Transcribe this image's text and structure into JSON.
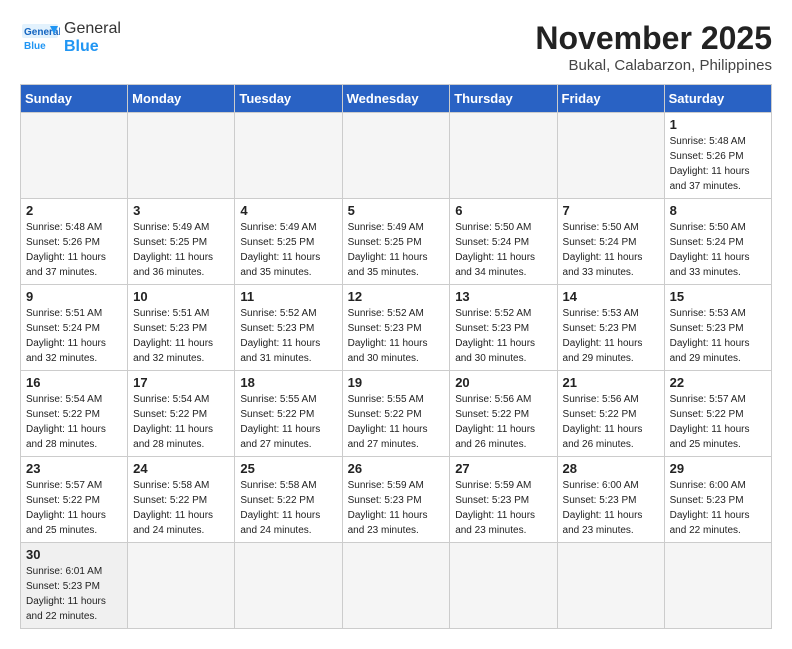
{
  "header": {
    "logo_general": "General",
    "logo_blue": "Blue",
    "month_title": "November 2025",
    "location": "Bukal, Calabarzon, Philippines"
  },
  "weekdays": [
    "Sunday",
    "Monday",
    "Tuesday",
    "Wednesday",
    "Thursday",
    "Friday",
    "Saturday"
  ],
  "weeks": [
    [
      {
        "day": "",
        "info": ""
      },
      {
        "day": "",
        "info": ""
      },
      {
        "day": "",
        "info": ""
      },
      {
        "day": "",
        "info": ""
      },
      {
        "day": "",
        "info": ""
      },
      {
        "day": "",
        "info": ""
      },
      {
        "day": "1",
        "info": "Sunrise: 5:48 AM\nSunset: 5:26 PM\nDaylight: 11 hours\nand 37 minutes."
      }
    ],
    [
      {
        "day": "2",
        "info": "Sunrise: 5:48 AM\nSunset: 5:26 PM\nDaylight: 11 hours\nand 37 minutes."
      },
      {
        "day": "3",
        "info": "Sunrise: 5:49 AM\nSunset: 5:25 PM\nDaylight: 11 hours\nand 36 minutes."
      },
      {
        "day": "4",
        "info": "Sunrise: 5:49 AM\nSunset: 5:25 PM\nDaylight: 11 hours\nand 35 minutes."
      },
      {
        "day": "5",
        "info": "Sunrise: 5:49 AM\nSunset: 5:25 PM\nDaylight: 11 hours\nand 35 minutes."
      },
      {
        "day": "6",
        "info": "Sunrise: 5:50 AM\nSunset: 5:24 PM\nDaylight: 11 hours\nand 34 minutes."
      },
      {
        "day": "7",
        "info": "Sunrise: 5:50 AM\nSunset: 5:24 PM\nDaylight: 11 hours\nand 33 minutes."
      },
      {
        "day": "8",
        "info": "Sunrise: 5:50 AM\nSunset: 5:24 PM\nDaylight: 11 hours\nand 33 minutes."
      }
    ],
    [
      {
        "day": "9",
        "info": "Sunrise: 5:51 AM\nSunset: 5:24 PM\nDaylight: 11 hours\nand 32 minutes."
      },
      {
        "day": "10",
        "info": "Sunrise: 5:51 AM\nSunset: 5:23 PM\nDaylight: 11 hours\nand 32 minutes."
      },
      {
        "day": "11",
        "info": "Sunrise: 5:52 AM\nSunset: 5:23 PM\nDaylight: 11 hours\nand 31 minutes."
      },
      {
        "day": "12",
        "info": "Sunrise: 5:52 AM\nSunset: 5:23 PM\nDaylight: 11 hours\nand 30 minutes."
      },
      {
        "day": "13",
        "info": "Sunrise: 5:52 AM\nSunset: 5:23 PM\nDaylight: 11 hours\nand 30 minutes."
      },
      {
        "day": "14",
        "info": "Sunrise: 5:53 AM\nSunset: 5:23 PM\nDaylight: 11 hours\nand 29 minutes."
      },
      {
        "day": "15",
        "info": "Sunrise: 5:53 AM\nSunset: 5:23 PM\nDaylight: 11 hours\nand 29 minutes."
      }
    ],
    [
      {
        "day": "16",
        "info": "Sunrise: 5:54 AM\nSunset: 5:22 PM\nDaylight: 11 hours\nand 28 minutes."
      },
      {
        "day": "17",
        "info": "Sunrise: 5:54 AM\nSunset: 5:22 PM\nDaylight: 11 hours\nand 28 minutes."
      },
      {
        "day": "18",
        "info": "Sunrise: 5:55 AM\nSunset: 5:22 PM\nDaylight: 11 hours\nand 27 minutes."
      },
      {
        "day": "19",
        "info": "Sunrise: 5:55 AM\nSunset: 5:22 PM\nDaylight: 11 hours\nand 27 minutes."
      },
      {
        "day": "20",
        "info": "Sunrise: 5:56 AM\nSunset: 5:22 PM\nDaylight: 11 hours\nand 26 minutes."
      },
      {
        "day": "21",
        "info": "Sunrise: 5:56 AM\nSunset: 5:22 PM\nDaylight: 11 hours\nand 26 minutes."
      },
      {
        "day": "22",
        "info": "Sunrise: 5:57 AM\nSunset: 5:22 PM\nDaylight: 11 hours\nand 25 minutes."
      }
    ],
    [
      {
        "day": "23",
        "info": "Sunrise: 5:57 AM\nSunset: 5:22 PM\nDaylight: 11 hours\nand 25 minutes."
      },
      {
        "day": "24",
        "info": "Sunrise: 5:58 AM\nSunset: 5:22 PM\nDaylight: 11 hours\nand 24 minutes."
      },
      {
        "day": "25",
        "info": "Sunrise: 5:58 AM\nSunset: 5:22 PM\nDaylight: 11 hours\nand 24 minutes."
      },
      {
        "day": "26",
        "info": "Sunrise: 5:59 AM\nSunset: 5:23 PM\nDaylight: 11 hours\nand 23 minutes."
      },
      {
        "day": "27",
        "info": "Sunrise: 5:59 AM\nSunset: 5:23 PM\nDaylight: 11 hours\nand 23 minutes."
      },
      {
        "day": "28",
        "info": "Sunrise: 6:00 AM\nSunset: 5:23 PM\nDaylight: 11 hours\nand 23 minutes."
      },
      {
        "day": "29",
        "info": "Sunrise: 6:00 AM\nSunset: 5:23 PM\nDaylight: 11 hours\nand 22 minutes."
      }
    ],
    [
      {
        "day": "30",
        "info": "Sunrise: 6:01 AM\nSunset: 5:23 PM\nDaylight: 11 hours\nand 22 minutes."
      },
      {
        "day": "",
        "info": ""
      },
      {
        "day": "",
        "info": ""
      },
      {
        "day": "",
        "info": ""
      },
      {
        "day": "",
        "info": ""
      },
      {
        "day": "",
        "info": ""
      },
      {
        "day": "",
        "info": ""
      }
    ]
  ]
}
